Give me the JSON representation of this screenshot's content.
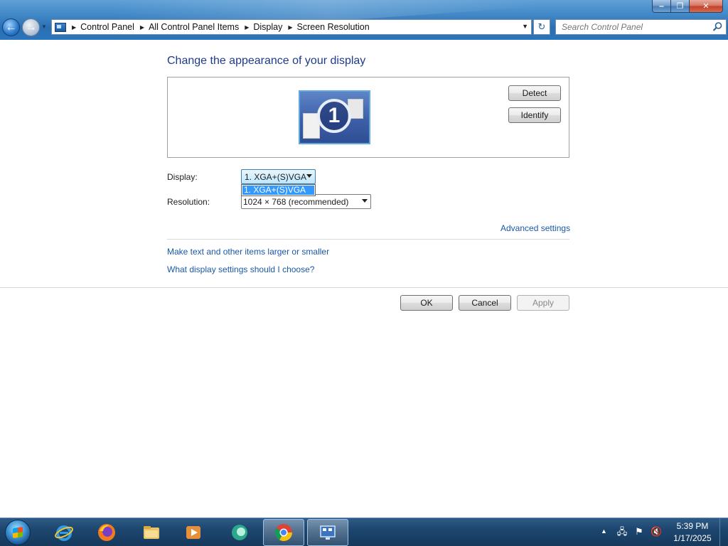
{
  "window": {
    "caption_buttons": {
      "minimize": "‒",
      "maximize": "❐",
      "close": "✕"
    }
  },
  "address_bar": {
    "crumbs": [
      "Control Panel",
      "All Control Panel Items",
      "Display",
      "Screen Resolution"
    ],
    "search_placeholder": "Search Control Panel"
  },
  "content": {
    "title": "Change the appearance of your display",
    "monitor_number": "1",
    "detect_label": "Detect",
    "identify_label": "Identify",
    "display_label": "Display:",
    "display_value": "1. XGA+(S)VGA",
    "display_options": [
      "1. XGA+(S)VGA"
    ],
    "resolution_label": "Resolution:",
    "resolution_value": "1024 × 768 (recommended)",
    "advanced_link": "Advanced settings",
    "link_text_size": "Make text and other items larger or smaller",
    "link_help": "What display settings should I choose?"
  },
  "footer": {
    "ok_label": "OK",
    "cancel_label": "Cancel",
    "apply_label": "Apply"
  },
  "taskbar": {
    "pinned": [
      "internet-explorer-icon",
      "firefox-icon",
      "file-explorer-icon",
      "media-player-icon",
      "messenger-icon",
      "chrome-icon",
      "display-settings-icon"
    ],
    "clock_time": "5:39 PM",
    "clock_date": "1/17/2025"
  },
  "colors": {
    "link": "#1a58a8",
    "title": "#1e3a8c",
    "selection": "#3399ff",
    "taskbar": "#1d466f"
  }
}
